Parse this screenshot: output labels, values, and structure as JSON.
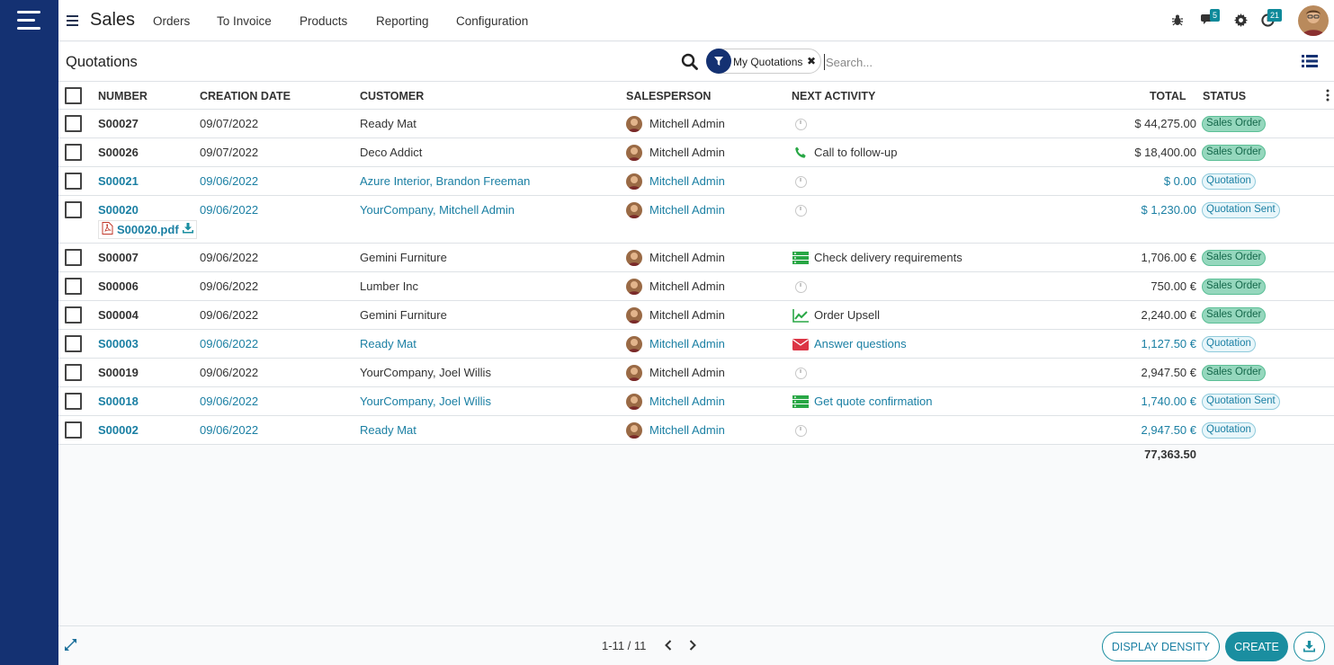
{
  "nav": {
    "app_title": "Sales",
    "menu": [
      "Orders",
      "To Invoice",
      "Products",
      "Reporting",
      "Configuration"
    ],
    "messages_badge": "5",
    "activities_badge": "21"
  },
  "control": {
    "page_title": "Quotations",
    "facet_label": "My Quotations",
    "search_placeholder": "Search..."
  },
  "table": {
    "headers": {
      "number": "NUMBER",
      "creation_date": "CREATION DATE",
      "customer": "CUSTOMER",
      "salesperson": "SALESPERSON",
      "next_activity": "NEXT ACTIVITY",
      "total": "TOTAL",
      "status": "STATUS"
    },
    "rows": [
      {
        "number": "S00027",
        "date": "09/07/2022",
        "customer": "Ready Mat",
        "salesperson": "Mitchell Admin",
        "activity": "",
        "activity_icon": "clock-icon",
        "total": "$ 44,275.00",
        "status": "Sales Order"
      },
      {
        "number": "S00026",
        "date": "09/07/2022",
        "customer": "Deco Addict",
        "salesperson": "Mitchell Admin",
        "activity": "Call to follow-up",
        "activity_icon": "phone-icon",
        "total": "$ 18,400.00",
        "status": "Sales Order"
      },
      {
        "number": "S00021",
        "date": "09/06/2022",
        "customer": "Azure Interior, Brandon Freeman",
        "salesperson": "Mitchell Admin",
        "activity": "",
        "activity_icon": "clock-icon",
        "total": "$ 0.00",
        "status": "Quotation"
      },
      {
        "number": "S00020",
        "date": "09/06/2022",
        "customer": "YourCompany, Mitchell Admin",
        "salesperson": "Mitchell Admin",
        "activity": "",
        "activity_icon": "clock-icon",
        "total": "$ 1,230.00",
        "status": "Quotation Sent",
        "attachment": "S00020.pdf"
      },
      {
        "number": "S00007",
        "date": "09/06/2022",
        "customer": "Gemini Furniture",
        "salesperson": "Mitchell Admin",
        "activity": "Check delivery requirements",
        "activity_icon": "tasks-icon",
        "total": "1,706.00 €",
        "status": "Sales Order"
      },
      {
        "number": "S00006",
        "date": "09/06/2022",
        "customer": "Lumber Inc",
        "salesperson": "Mitchell Admin",
        "activity": "",
        "activity_icon": "clock-icon",
        "total": "750.00 €",
        "status": "Sales Order"
      },
      {
        "number": "S00004",
        "date": "09/06/2022",
        "customer": "Gemini Furniture",
        "salesperson": "Mitchell Admin",
        "activity": "Order Upsell",
        "activity_icon": "line-chart-icon",
        "total": "2,240.00 €",
        "status": "Sales Order"
      },
      {
        "number": "S00003",
        "date": "09/06/2022",
        "customer": "Ready Mat",
        "salesperson": "Mitchell Admin",
        "activity": "Answer questions",
        "activity_icon": "envelope-icon",
        "total": "1,127.50 €",
        "status": "Quotation"
      },
      {
        "number": "S00019",
        "date": "09/06/2022",
        "customer": "YourCompany, Joel Willis",
        "salesperson": "Mitchell Admin",
        "activity": "",
        "activity_icon": "clock-icon",
        "total": "2,947.50 €",
        "status": "Sales Order"
      },
      {
        "number": "S00018",
        "date": "09/06/2022",
        "customer": "YourCompany, Joel Willis",
        "salesperson": "Mitchell Admin",
        "activity": "Get quote confirmation",
        "activity_icon": "tasks-icon",
        "total": "1,740.00 €",
        "status": "Quotation Sent"
      },
      {
        "number": "S00002",
        "date": "09/06/2022",
        "customer": "Ready Mat",
        "salesperson": "Mitchell Admin",
        "activity": "",
        "activity_icon": "clock-icon",
        "total": "2,947.50 €",
        "status": "Quotation"
      }
    ],
    "grand_total": "77,363.50"
  },
  "footer": {
    "pager": "1-11 / 11",
    "display_density": "DISPLAY DENSITY",
    "create": "CREATE"
  },
  "colors": {
    "brand": "#143172",
    "accent": "#1a8ea0",
    "link": "#1a7fa3",
    "sales_order_badge": "#95d7bd"
  }
}
